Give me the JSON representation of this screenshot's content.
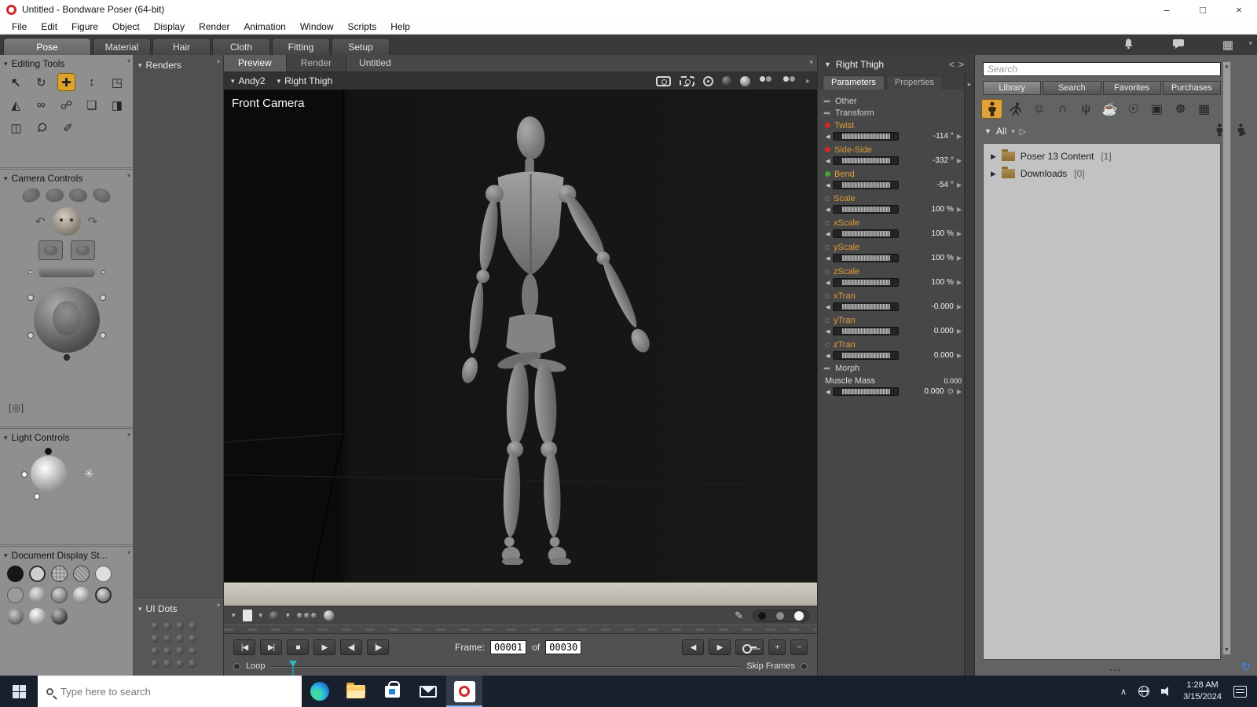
{
  "titlebar": {
    "title": "Untitled - Bondware Poser (64-bit)",
    "minimize": "–",
    "maximize": "□",
    "close": "×"
  },
  "menubar": {
    "items": [
      "File",
      "Edit",
      "Figure",
      "Object",
      "Display",
      "Render",
      "Animation",
      "Window",
      "Scripts",
      "Help"
    ]
  },
  "room_tabs": {
    "tabs": [
      "Pose",
      "Material",
      "Hair",
      "Cloth",
      "Fitting",
      "Setup"
    ],
    "active": "Pose"
  },
  "left_panel": {
    "editing_tools_title": "Editing Tools",
    "camera_controls_title": "Camera Controls",
    "light_controls_title": "Light Controls",
    "document_display_title": "Document Display St..."
  },
  "renders_panel": {
    "title": "Renders",
    "ui_dots_title": "UI Dots"
  },
  "document": {
    "tabs": [
      "Preview",
      "Render"
    ],
    "active_tab": "Preview",
    "title": "Untitled",
    "figure_menu": "Andy2",
    "actor_menu": "Right Thigh",
    "camera_name": "Front Camera"
  },
  "timeline": {
    "frame_label": "Frame:",
    "current_frame": "00001",
    "of_label": "of",
    "total_frames": "00030",
    "loop_label": "Loop",
    "skip_frames_label": "Skip Frames"
  },
  "parameters_panel": {
    "actor_name": "Right Thigh",
    "tabs": [
      "Parameters",
      "Properties"
    ],
    "active_tab": "Parameters",
    "sections": {
      "other": "Other",
      "transform": "Transform",
      "morph": "Morph"
    },
    "dials": [
      {
        "label": "Twist",
        "value": "-114 °",
        "status": "red"
      },
      {
        "label": "Side-Side",
        "value": "-332 °",
        "status": "red"
      },
      {
        "label": "Bend",
        "value": "-54 °",
        "status": "green"
      },
      {
        "label": "Scale",
        "value": "100 %",
        "status": "none"
      },
      {
        "label": "xScale",
        "value": "100 %",
        "status": "none"
      },
      {
        "label": "yScale",
        "value": "100 %",
        "status": "none"
      },
      {
        "label": "zScale",
        "value": "100 %",
        "status": "none"
      },
      {
        "label": "xTran",
        "value": "-0.000",
        "status": "none"
      },
      {
        "label": "yTran",
        "value": "0.000",
        "status": "none"
      },
      {
        "label": "zTran",
        "value": "0.000",
        "status": "none"
      }
    ],
    "morph_dial": {
      "label": "Muscle Mass",
      "value_top": "0.000",
      "value_bottom": "0.000"
    }
  },
  "library_panel": {
    "search_placeholder": "Search",
    "tabs": [
      "Library",
      "Search",
      "Favorites",
      "Purchases"
    ],
    "active_tab": "Library",
    "filter_label": "All",
    "tree": [
      {
        "label": "Poser 13 Content",
        "count": "[1]"
      },
      {
        "label": "Downloads",
        "count": "[0]"
      }
    ],
    "more_label": "...",
    "category_icons": [
      "figures",
      "poses",
      "expressions",
      "hair",
      "hands",
      "props",
      "lights",
      "cameras",
      "materials",
      "scene"
    ]
  },
  "taskbar": {
    "search_placeholder": "Type here to search",
    "time": "1:28 AM",
    "date": "3/15/2024"
  },
  "colors": {
    "accent_orange": "#dfa12f",
    "status_red": "#cc2b22",
    "status_green": "#43a32e",
    "taskbar_bg": "#18202e",
    "viewport_bg": "#121212"
  }
}
